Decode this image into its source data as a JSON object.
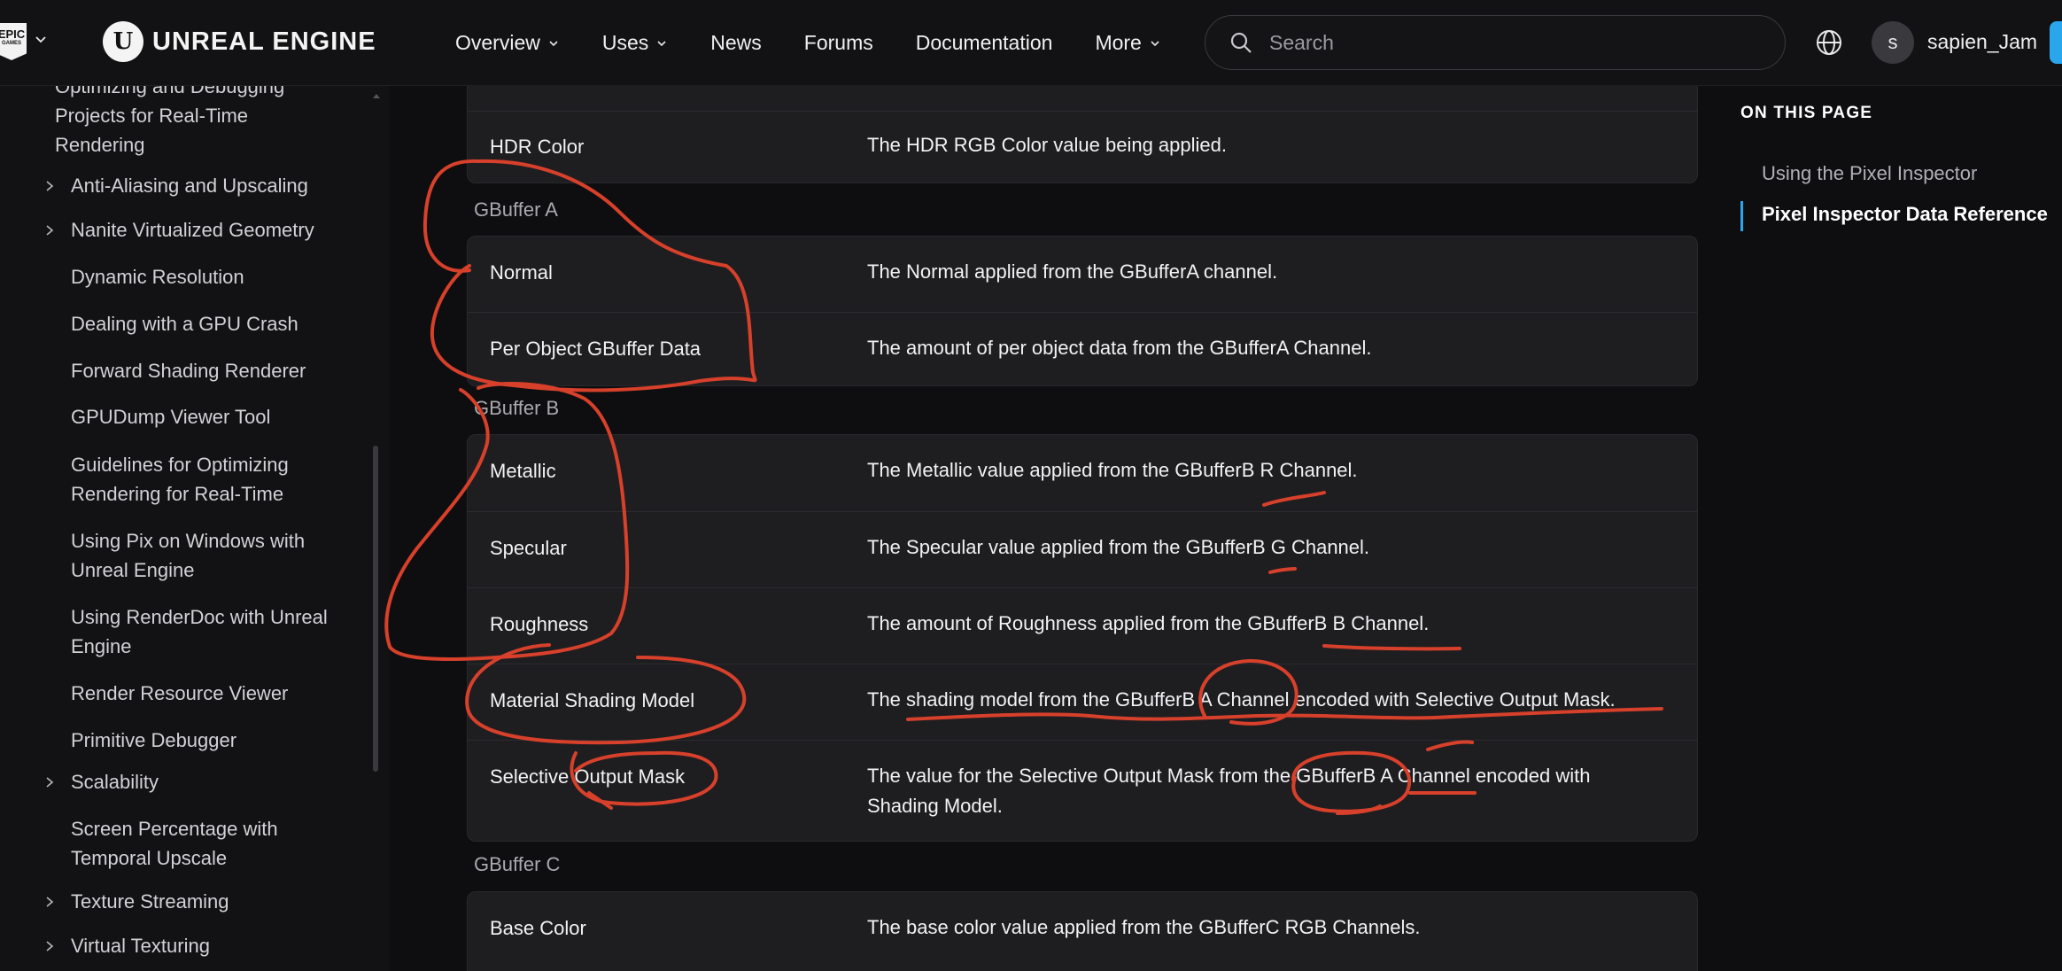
{
  "header": {
    "epic_logo_text": "EPIC",
    "epic_logo_sub": "GAMES",
    "brand": "UNREAL ENGINE",
    "nav": [
      {
        "label": "Overview",
        "dropdown": true
      },
      {
        "label": "Uses",
        "dropdown": true
      },
      {
        "label": "News",
        "dropdown": false
      },
      {
        "label": "Forums",
        "dropdown": false
      },
      {
        "label": "Documentation",
        "dropdown": false
      },
      {
        "label": "More",
        "dropdown": true
      }
    ],
    "search_placeholder": "Search",
    "avatar_initial": "s",
    "username": "sapien_Jam"
  },
  "sidebar": {
    "items": [
      {
        "label": "Optimizing and Debugging Projects for Real-Time Rendering",
        "expandable": false
      },
      {
        "label": "Anti-Aliasing and Upscaling",
        "expandable": true
      },
      {
        "label": "Nanite Virtualized Geometry",
        "expandable": true
      },
      {
        "label": "Dynamic Resolution",
        "expandable": false
      },
      {
        "label": "Dealing with a GPU Crash",
        "expandable": false
      },
      {
        "label": "Forward Shading Renderer",
        "expandable": false
      },
      {
        "label": "GPUDump Viewer Tool",
        "expandable": false
      },
      {
        "label": "Guidelines for Optimizing Rendering for Real-Time",
        "expandable": false
      },
      {
        "label": "Using Pix on Windows with Unreal Engine",
        "expandable": false
      },
      {
        "label": "Using RenderDoc with Unreal Engine",
        "expandable": false
      },
      {
        "label": "Render Resource Viewer",
        "expandable": false
      },
      {
        "label": "Primitive Debugger",
        "expandable": false
      },
      {
        "label": "Scalability",
        "expandable": true
      },
      {
        "label": "Screen Percentage with Temporal Upscale",
        "expandable": false
      },
      {
        "label": "Texture Streaming",
        "expandable": true
      },
      {
        "label": "Virtual Texturing",
        "expandable": true
      }
    ]
  },
  "content": {
    "top_table": [
      {
        "name": "HDR Color",
        "desc": "The HDR RGB Color value being applied."
      }
    ],
    "gbuffer_a": {
      "label": "GBuffer A",
      "rows": [
        {
          "name": "Normal",
          "desc": "The Normal applied from the GBufferA channel."
        },
        {
          "name": "Per Object GBuffer Data",
          "desc": "The amount of per object data from the GBufferA Channel."
        }
      ]
    },
    "gbuffer_b": {
      "label": "GBuffer B",
      "rows": [
        {
          "name": "Metallic",
          "desc": "The Metallic value applied from the GBufferB R Channel."
        },
        {
          "name": "Specular",
          "desc": "The Specular value applied from the GBufferB G Channel."
        },
        {
          "name": "Roughness",
          "desc": "The amount of Roughness applied from the GBufferB B Channel."
        },
        {
          "name": "Material Shading Model",
          "desc": "The shading model from the GBufferB A Channel encoded with Selective Output Mask."
        },
        {
          "name": "Selective Output Mask",
          "desc": "The value for the Selective Output Mask from the GBufferB A Channel encoded with Shading Model."
        }
      ]
    },
    "gbuffer_c": {
      "label": "GBuffer C",
      "rows": [
        {
          "name": "Base Color",
          "desc": "The base color value applied from the GBufferC RGB Channels."
        }
      ]
    }
  },
  "on_this_page": {
    "title": "ON THIS PAGE",
    "links": [
      {
        "label": "Using the Pixel Inspector",
        "active": false
      },
      {
        "label": "Pixel Inspector Data Reference",
        "active": true
      }
    ]
  },
  "annotation_color": "#d7402a",
  "accent_color": "#2aa7ec"
}
